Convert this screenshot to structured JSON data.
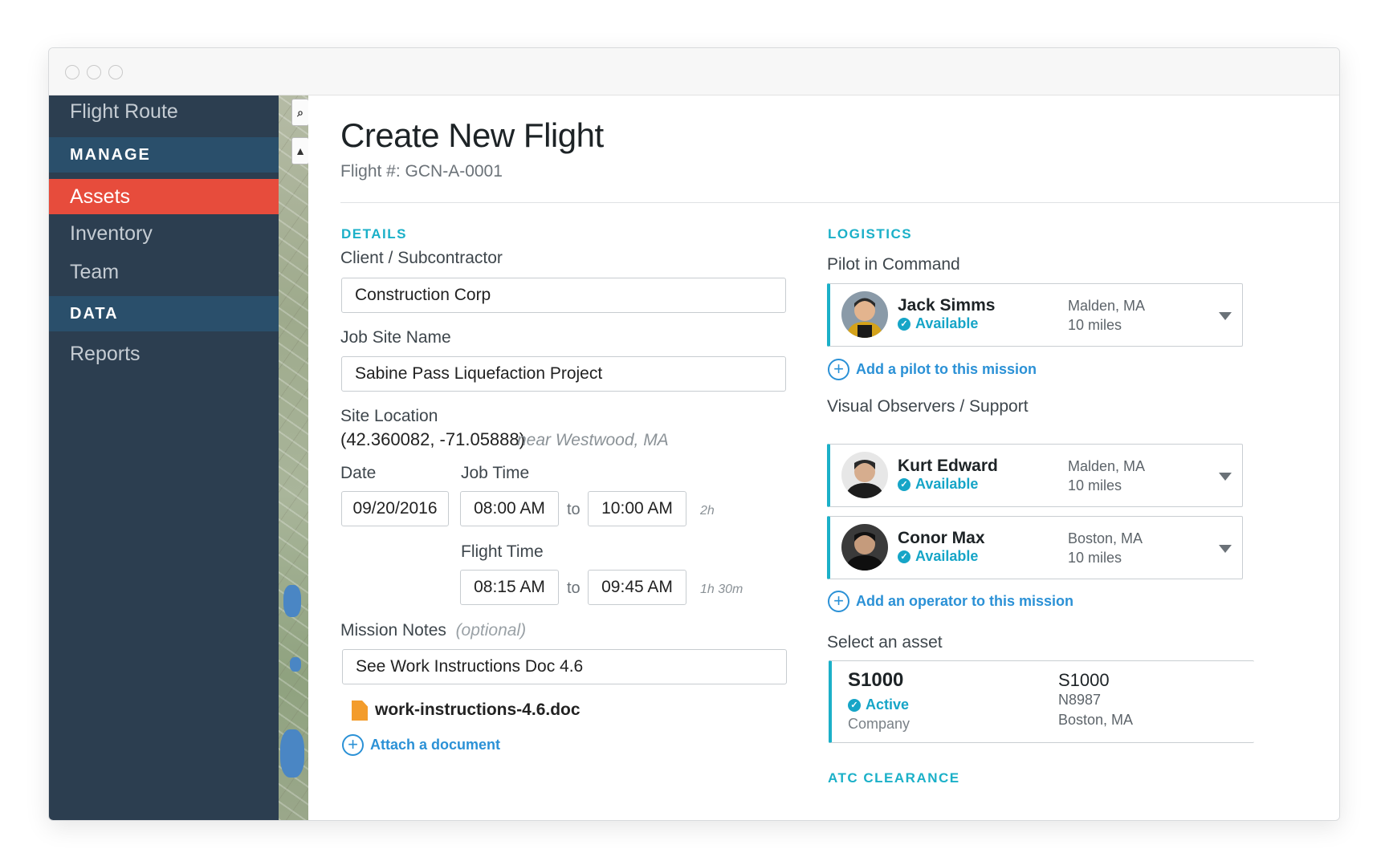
{
  "sidebar": {
    "items": [
      {
        "label": "Flight Route"
      },
      {
        "section": "MANAGE"
      },
      {
        "label": "Assets",
        "active": true
      },
      {
        "label": "Inventory"
      },
      {
        "label": "Team"
      },
      {
        "section": "DATA"
      },
      {
        "label": "Reports"
      }
    ]
  },
  "page": {
    "title": "Create New Flight",
    "flight_number": "Flight #: GCN-A-0001"
  },
  "details": {
    "heading": "DETAILS",
    "client_label": "Client / Subcontractor",
    "client_value": "Construction Corp",
    "site_label": "Job Site Name",
    "site_value": "Sabine Pass Liquefaction Project",
    "location_label": "Site Location",
    "location_coords": "(42.360082, -71.05888)",
    "location_near": "near Westwood, MA",
    "date_label": "Date",
    "date_value": "09/20/2016",
    "job_time_label": "Job Time",
    "job_start": "08:00 AM",
    "job_to": "to",
    "job_end": "10:00 AM",
    "job_duration": "2h",
    "flight_time_label": "Flight Time",
    "flight_start": "08:15 AM",
    "flight_to": "to",
    "flight_end": "09:45 AM",
    "flight_duration": "1h 30m",
    "notes_label": "Mission Notes",
    "notes_optional": "(optional)",
    "notes_value": "See Work Instructions Doc 4.6",
    "attachment": "work-instructions-4.6.doc",
    "attach_link": "Attach a document"
  },
  "logistics": {
    "heading": "LOGISTICS",
    "pilot_label": "Pilot in Command",
    "pilot": {
      "name": "Jack Simms",
      "status": "Available",
      "location": "Malden, MA",
      "distance": "10 miles"
    },
    "add_pilot": "Add a pilot to this mission",
    "observers_label": "Visual Observers / Support",
    "observers": [
      {
        "name": "Kurt Edward",
        "status": "Available",
        "location": "Malden, MA",
        "distance": "10 miles"
      },
      {
        "name": "Conor Max",
        "status": "Available",
        "location": "Boston, MA",
        "distance": "10 miles"
      }
    ],
    "add_operator": "Add an operator to this mission",
    "asset_label": "Select an asset",
    "asset": {
      "name": "S1000",
      "status": "Active",
      "owner": "Company",
      "model": "S1000",
      "tail": "N8987",
      "location": "Boston, MA"
    },
    "atc_heading": "ATC CLEARANCE"
  },
  "colors": {
    "sidebar": "#2c3e50",
    "section": "#2a4f6b",
    "active": "#e74c3c",
    "accent": "#1bb0c8",
    "link": "#2b91d6",
    "file": "#f39c2b"
  },
  "icons": [
    "plus-circle-icon",
    "check-circle-icon",
    "chevron-down-icon",
    "document-icon"
  ]
}
